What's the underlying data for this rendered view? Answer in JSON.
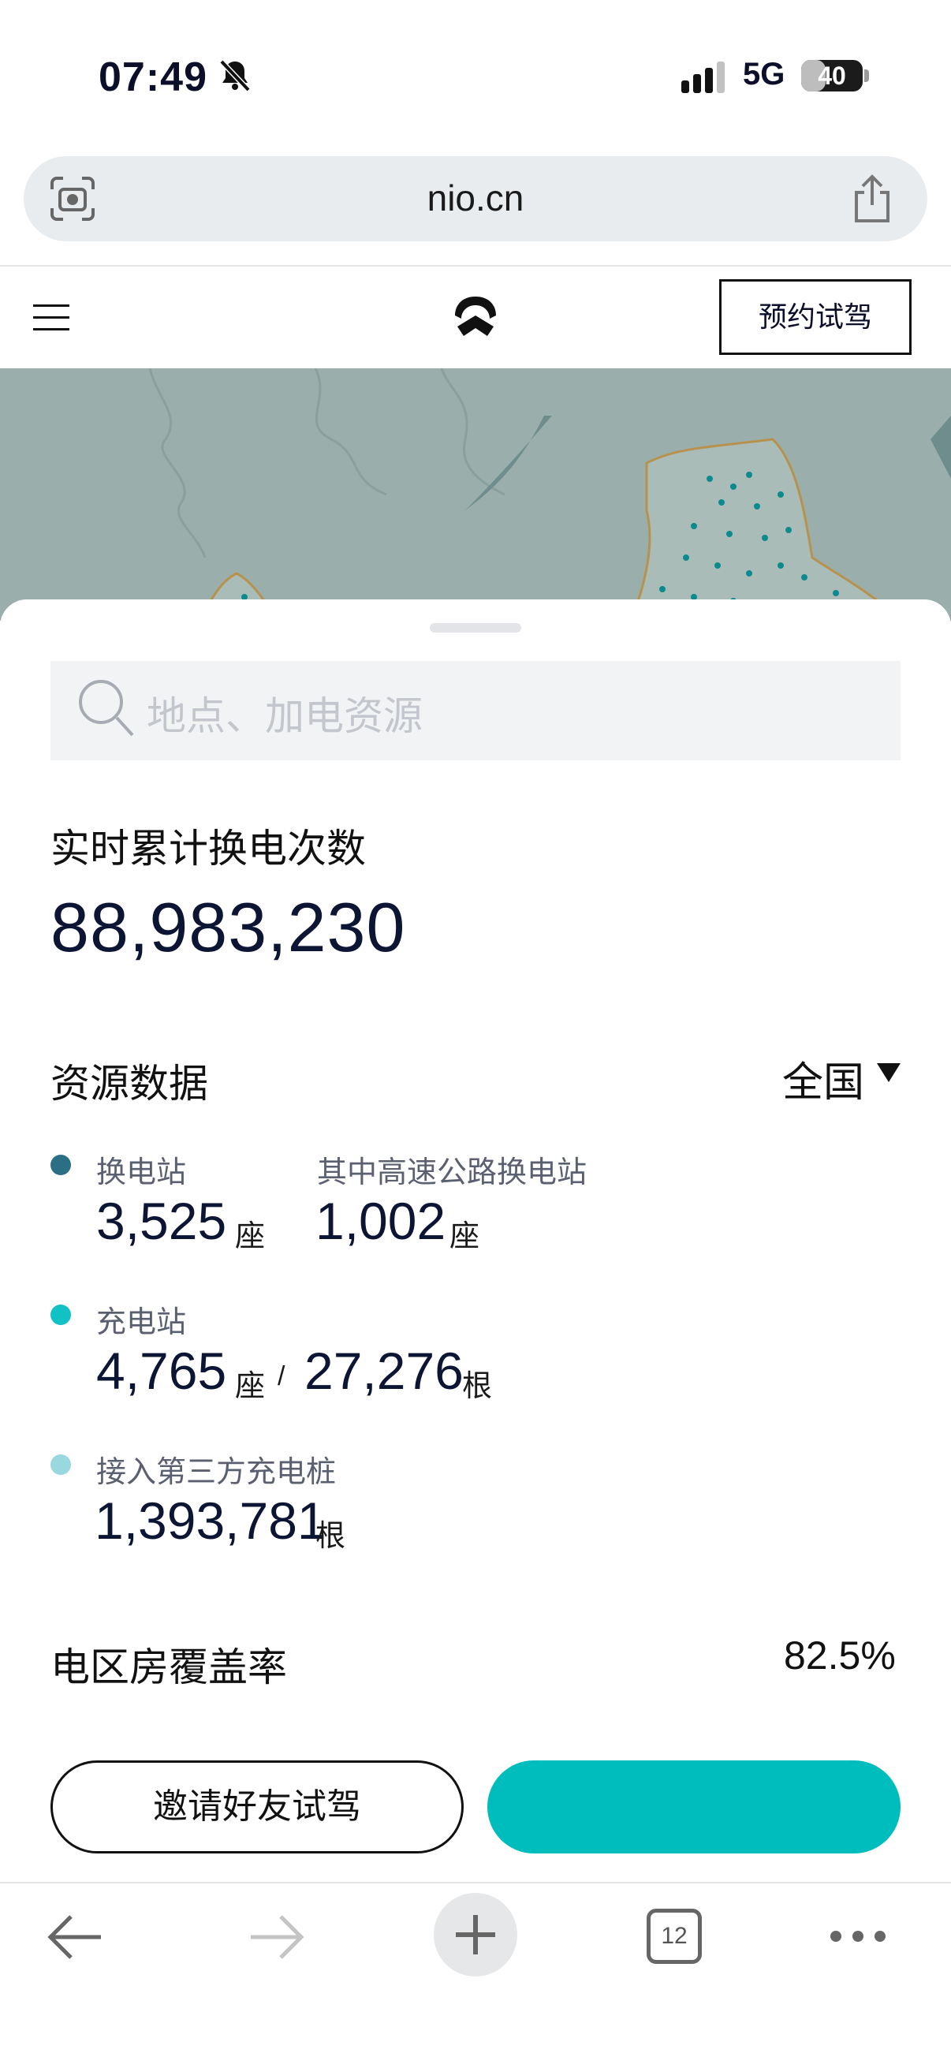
{
  "status_bar": {
    "time": "07:49",
    "network": "5G",
    "battery": "40",
    "battery_level": 0.4
  },
  "browser": {
    "url": "nio.cn",
    "tab_count": "12"
  },
  "nav": {
    "cta_label": "预约试驾"
  },
  "search": {
    "placeholder": "地点、加电资源"
  },
  "swap_total": {
    "label": "实时累计换电次数",
    "value": "88,983,230"
  },
  "resources": {
    "label": "资源数据",
    "region": "全国",
    "swap_station": {
      "label": "换电站",
      "count": "3,525",
      "unit": "座",
      "color": "#2b6f84"
    },
    "highway_swap": {
      "label": "其中高速公路换电站",
      "count": "1,002",
      "unit": "座"
    },
    "charging_station": {
      "label": "充电站",
      "count": "4,765",
      "unit": "座",
      "separator": "/",
      "piles": "27,276",
      "piles_unit": "根",
      "color": "#11c1c3"
    },
    "third_party": {
      "label": "接入第三方充电桩",
      "count": "1,393,781",
      "unit": "根",
      "color": "#9ad8e0"
    }
  },
  "coverage": {
    "label": "电区房覆盖率",
    "value": "82.5%"
  },
  "actions": {
    "invite_label": "邀请好友试驾",
    "primary_color": "#00bdbd"
  }
}
